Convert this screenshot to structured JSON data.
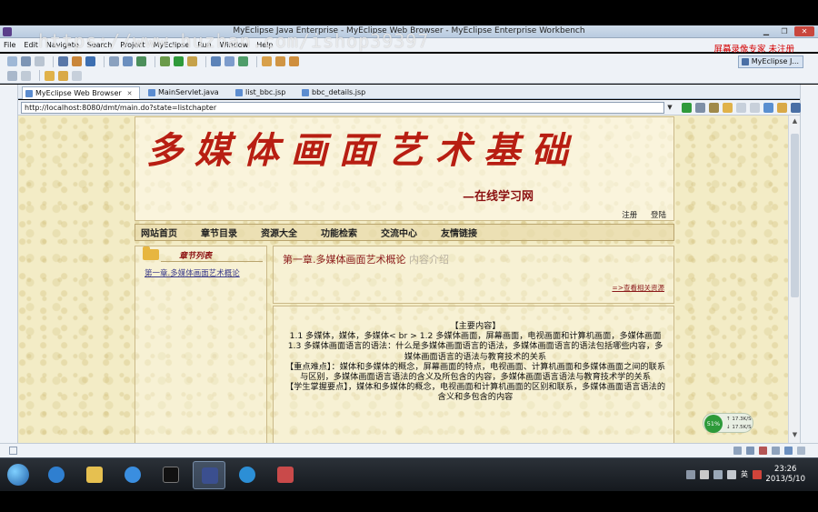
{
  "window": {
    "title": "MyEclipse Java Enterprise - MyEclipse Web Browser - MyEclipse Enterprise Workbench",
    "watermark": "https://www.huzhan.com/ishop39397",
    "recorder_label": "屏幕录像专家  未注册",
    "perspective": "MyEclipse J...",
    "min_icon": "▁",
    "max_icon": "❐",
    "close_icon": "✕"
  },
  "menu": [
    "File",
    "Edit",
    "Navigate",
    "Search",
    "Project",
    "MyEclipse",
    "Run",
    "Window",
    "Help"
  ],
  "tabs": [
    {
      "label": "MyEclipse Web Browser",
      "close": "✕"
    },
    {
      "label": "MainServlet.java"
    },
    {
      "label": "list_bbc.jsp"
    },
    {
      "label": "bbc_details.jsp"
    }
  ],
  "browser": {
    "url": "http://localhost:8080/dmt/main.do?state=listchapter",
    "dropdown": "▼"
  },
  "site": {
    "title": "多媒体画面艺术基础",
    "subtitle": "—在线学习网",
    "login_links": [
      "注册",
      "登陆"
    ],
    "nav": [
      "网站首页",
      "章节目录",
      "资源大全",
      "功能检索",
      "交流中心",
      "友情链接"
    ],
    "sidebar_heading": "章节列表",
    "sidebar_link": "第一章.多媒体画面艺术概论",
    "chapter_title": "第一章.多媒体画面艺术概论",
    "chapter_title_faded": " 内容介绍",
    "resource_link": "=>查看相关资源",
    "description": [
      "【主要内容】",
      "1.1 多媒体，媒体，多媒体< br > 1.2 多媒体画面，屏幕画面，电视画面和计算机画面，多媒体画面",
      "1.3 多媒体画面语言的语法：什么是多媒体画面语言的语法，多媒体画面语言的语法包括哪些内容，多媒体画面语言的语法与教育技术的关系",
      "【重点难点】：媒体和多媒体的概念，屏幕画面的特点，电视画面、计算机画面和多媒体画面之间的联系与区别，多媒体画面语言语法的含义及所包含的内容，多媒体画面语言语法与教育技术学的关系",
      "【学生掌握要点】，媒体和多媒体的概念，电视画面和计算机画面的区别和联系，多媒体画面语言语法的含义和多包含的内容"
    ]
  },
  "netmon": {
    "percent": "51%",
    "up": "↑ 17.3K/S",
    "down": "↓ 17.5K/S"
  },
  "scroll": {
    "up": "▲",
    "down": "▼"
  },
  "tray": {
    "ime": "英"
  },
  "clock": {
    "time": "23:26",
    "date": "2013/5/10"
  },
  "colors": {
    "page_bg": "#f3ecc6",
    "banner_red": "#b81e12",
    "link_red": "#8b1a1a",
    "recorder_red": "#d40000"
  }
}
